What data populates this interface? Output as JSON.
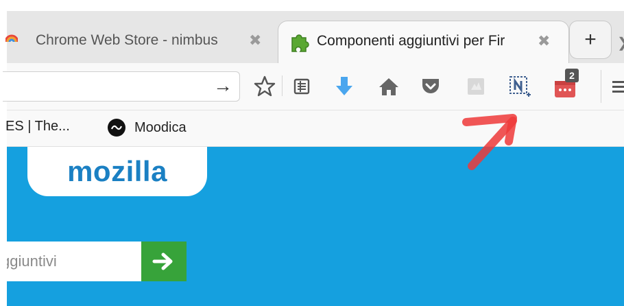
{
  "tabs": [
    {
      "title": "Chrome Web Store - nimbus",
      "active": false,
      "favicon": "rainbow-favicon-icon"
    },
    {
      "title": "Componenti aggiuntivi per Fir",
      "active": true,
      "favicon": "puzzle-piece-icon"
    }
  ],
  "newtab_label": "+",
  "nav": {
    "go_arrow": "→",
    "icons": [
      "bookmark-star-icon",
      "reading-list-icon",
      "download-icon",
      "home-icon",
      "pocket-icon",
      "extension-gray-icon",
      "nimbus-screenshot-icon",
      "notification-calendar-icon",
      "menu-icon"
    ],
    "badge_count": "2"
  },
  "bookmarks": [
    {
      "label": "ES | The...",
      "icon": ""
    },
    {
      "label": "Moodica",
      "icon": "moodica-icon"
    }
  ],
  "content": {
    "logo": "mozilla",
    "search_value": "ggiuntivi",
    "search_button": "→"
  },
  "colors": {
    "content_bg": "#15a0df",
    "logo": "#1b80c3",
    "search_button": "#37a33a",
    "annotation_arrow": "#ee3a3a",
    "badge_bg": "#555555"
  }
}
